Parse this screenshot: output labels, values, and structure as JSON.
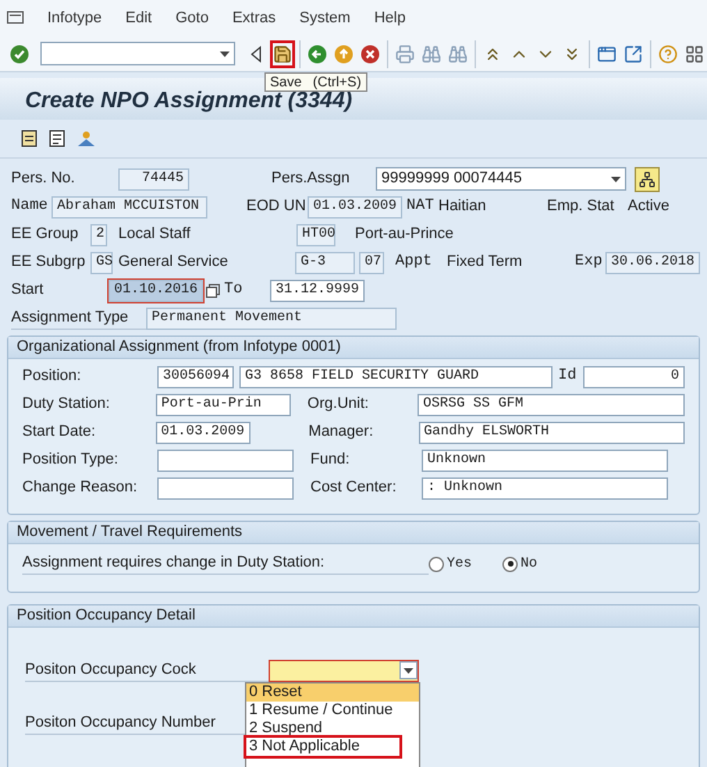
{
  "menu": [
    "Infotype",
    "Edit",
    "Goto",
    "Extras",
    "System",
    "Help"
  ],
  "toolbar": {
    "groups": [
      [
        {
          "kind": "enter",
          "highlighted": false
        }
      ],
      [
        {
          "kind": "command"
        }
      ],
      [
        {
          "kind": "collapse",
          "highlighted": false
        },
        {
          "kind": "save",
          "highlighted": true
        }
      ],
      [
        {
          "kind": "back",
          "highlighted": false
        },
        {
          "kind": "exit",
          "highlighted": false
        },
        {
          "kind": "cancel",
          "highlighted": false
        }
      ],
      [
        {
          "kind": "print",
          "highlighted": false
        },
        {
          "kind": "find",
          "highlighted": false
        },
        {
          "kind": "find_next",
          "highlighted": false
        }
      ],
      [
        {
          "kind": "first_page",
          "highlighted": false
        },
        {
          "kind": "prev_page",
          "highlighted": false
        },
        {
          "kind": "next_page",
          "highlighted": false
        },
        {
          "kind": "last_page",
          "highlighted": false
        }
      ],
      [
        {
          "kind": "new_session",
          "highlighted": false
        },
        {
          "kind": "shortcut",
          "highlighted": false
        }
      ],
      [
        {
          "kind": "help",
          "highlighted": false
        },
        {
          "kind": "layout",
          "highlighted": false
        }
      ]
    ],
    "tooltip": {
      "title": "Save",
      "shortcut": "(Ctrl+S)"
    }
  },
  "title": "Create NPO Assignment (3344)",
  "header": {
    "pers_no": {
      "label": "Pers. No.",
      "value": "74445"
    },
    "pers_assgn": {
      "label": "Pers.Assgn",
      "value": "99999999 00074445"
    },
    "name": {
      "label": "Name",
      "value": "Abraham MCCUISTON"
    },
    "eod": {
      "label": "EOD UN",
      "value": "01.03.2009"
    },
    "nat": {
      "label": "NAT",
      "value": "Haitian"
    },
    "emp_stat": {
      "label": "Emp. Stat",
      "value": "Active"
    },
    "ee_group": {
      "label": "EE Group",
      "code": "2",
      "text": "Local Staff"
    },
    "location": {
      "code": "HT00",
      "text": "Port-au-Prince"
    },
    "ee_subgrp": {
      "label": "EE Subgrp",
      "code": "GS",
      "text": "General Service"
    },
    "grade": {
      "value": "G-3",
      "step": "07"
    },
    "appt": {
      "label": "Appt",
      "value": "Fixed Term"
    },
    "exp": {
      "label": "Exp",
      "value": "30.06.2018"
    },
    "start": {
      "label": "Start",
      "value": "01.10.2016",
      "focused": true
    },
    "to": {
      "label": "To",
      "value": "31.12.9999"
    },
    "assignment_type": {
      "label": "Assignment Type",
      "value": "Permanent Movement"
    }
  },
  "org": {
    "title": "Organizational Assignment (from Infotype 0001)",
    "position": {
      "label": "Position:",
      "value": "30056094",
      "description": "G3 8658 FIELD SECURITY GUARD",
      "id_label": "Id",
      "id_value": "0"
    },
    "rows": [
      {
        "left": {
          "label": "Duty Station:",
          "value": "Port-au-Prin"
        },
        "right": {
          "label": "Org.Unit:",
          "value": "OSRSG SS GFM"
        }
      },
      {
        "left": {
          "label": "Start Date:",
          "value": "01.03.2009"
        },
        "right": {
          "label": "Manager:",
          "value": "Gandhy ELSWORTH"
        }
      },
      {
        "left": {
          "label": "Position Type:"
        },
        "right": {
          "label": "Fund:",
          "value": "Unknown"
        }
      },
      {
        "left": {
          "label": "Change Reason:"
        },
        "right": {
          "label": "Cost Center:",
          "value": ": Unknown"
        }
      }
    ]
  },
  "movement": {
    "title": "Movement / Travel Requirements",
    "question": "Assignment requires change in Duty Station:",
    "options": [
      {
        "label": "Yes",
        "selected": false
      },
      {
        "label": "No",
        "selected": true
      }
    ]
  },
  "occupancy": {
    "title": "Position Occupancy Detail",
    "clock": {
      "label": "Positon Occupancy Cock",
      "expanded": true,
      "options": [
        {
          "code": "0",
          "label": "Reset",
          "selected": true,
          "highlighted": false
        },
        {
          "code": "1",
          "label": "Resume / Continue",
          "selected": false,
          "highlighted": false
        },
        {
          "code": "2",
          "label": "Suspend",
          "selected": false,
          "highlighted": false
        },
        {
          "code": "3",
          "label": "Not Applicable",
          "selected": false,
          "highlighted": true
        }
      ]
    },
    "number": {
      "label": "Positon Occupancy Number"
    }
  }
}
